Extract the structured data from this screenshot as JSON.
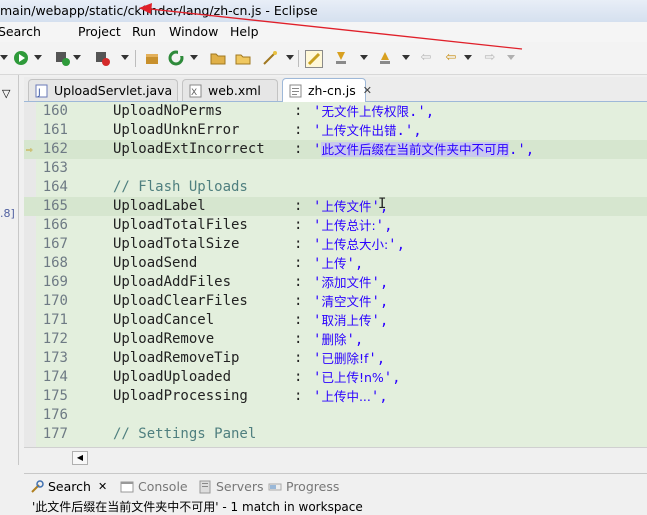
{
  "window": {
    "title": "main/webapp/static/ckfinder/lang/zh-cn.js - Eclipse"
  },
  "menu": [
    "Search",
    "Project",
    "Run",
    "Window",
    "Help"
  ],
  "tabs": [
    {
      "label": "UploadServlet.java",
      "icon": "java-file-icon",
      "active": false
    },
    {
      "label": "web.xml",
      "icon": "xml-file-icon",
      "active": false
    },
    {
      "label": "zh-cn.js",
      "icon": "js-file-icon",
      "active": true
    }
  ],
  "left_marker": ".8]",
  "code_lines": [
    {
      "num": "160",
      "key": "UploadNoPerms",
      "colon": ":",
      "pre": "'",
      "cn": "无文件上传权限",
      "post": ".',"
    },
    {
      "num": "161",
      "key": "UploadUnknError",
      "colon": ":",
      "pre": "'",
      "cn": "上传文件出错",
      "post": ".',"
    },
    {
      "num": "162",
      "key": "UploadExtIncorrect",
      "colon": ":",
      "pre": "'",
      "cn": "此文件后缀在当前文件夹中不可用",
      "post": ".',",
      "current": true,
      "selected": true
    },
    {
      "num": "163",
      "key": "",
      "colon": "",
      "pre": "",
      "cn": "",
      "post": ""
    },
    {
      "num": "164",
      "key": "// Flash Uploads",
      "colon": "",
      "pre": "",
      "cn": "",
      "post": "",
      "comment": true
    },
    {
      "num": "165",
      "key": "UploadLabel",
      "colon": ":",
      "pre": "'",
      "cn": "上传文件",
      "post": "',",
      "current": true
    },
    {
      "num": "166",
      "key": "UploadTotalFiles",
      "colon": ":",
      "pre": "'",
      "cn": "上传总计:",
      "post": "',"
    },
    {
      "num": "167",
      "key": "UploadTotalSize",
      "colon": ":",
      "pre": "'",
      "cn": "上传总大小:",
      "post": "',"
    },
    {
      "num": "168",
      "key": "UploadSend",
      "colon": ":",
      "pre": "'",
      "cn": "上传",
      "post": "',"
    },
    {
      "num": "169",
      "key": "UploadAddFiles",
      "colon": ":",
      "pre": "'",
      "cn": "添加文件",
      "post": "',"
    },
    {
      "num": "170",
      "key": "UploadClearFiles",
      "colon": ":",
      "pre": "'",
      "cn": "清空文件",
      "post": "',"
    },
    {
      "num": "171",
      "key": "UploadCancel",
      "colon": ":",
      "pre": "'",
      "cn": "取消上传",
      "post": "',"
    },
    {
      "num": "172",
      "key": "UploadRemove",
      "colon": ":",
      "pre": "'",
      "cn": "删除",
      "post": "',"
    },
    {
      "num": "173",
      "key": "UploadRemoveTip",
      "colon": ":",
      "pre": "'",
      "cn": "已删除!f",
      "post": "',"
    },
    {
      "num": "174",
      "key": "UploadUploaded",
      "colon": ":",
      "pre": "'",
      "cn": "已上传!n%",
      "post": "',"
    },
    {
      "num": "175",
      "key": "UploadProcessing",
      "colon": ":",
      "pre": "'",
      "cn": "上传中...",
      "post": "',"
    },
    {
      "num": "176",
      "key": "",
      "colon": "",
      "pre": "",
      "cn": "",
      "post": ""
    },
    {
      "num": "177",
      "key": "// Settings Panel",
      "colon": "",
      "pre": "",
      "cn": "",
      "post": "",
      "comment": true
    }
  ],
  "views": [
    {
      "label": "Search",
      "icon": "search-view-icon",
      "active": true
    },
    {
      "label": "Console",
      "icon": "console-icon",
      "active": false
    },
    {
      "label": "Servers",
      "icon": "servers-icon",
      "active": false
    },
    {
      "label": "Progress",
      "icon": "progress-icon",
      "active": false
    }
  ],
  "search_result": "'此文件后缀在当前文件夹中不可用' - 1 match in workspace",
  "colors": {
    "editor_bg": "#e3efdd",
    "string": "#2a00ff",
    "comment": "#4f7f7f",
    "annotation": "#e0202a"
  }
}
